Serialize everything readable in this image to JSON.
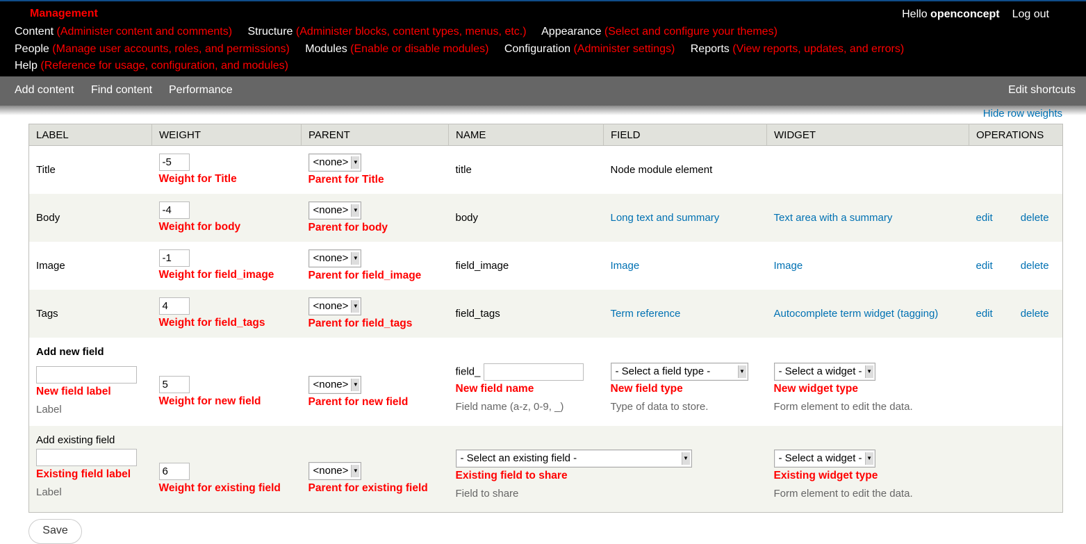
{
  "toolbar": {
    "title": "Management",
    "user_greeting": "Hello",
    "username": "openconcept",
    "logout": "Log out",
    "menu": [
      {
        "label": "Content",
        "desc": "(Administer content and comments)"
      },
      {
        "label": "Structure",
        "desc": "(Administer blocks, content types, menus, etc.)"
      },
      {
        "label": "Appearance",
        "desc": "(Select and configure your themes)"
      },
      {
        "label": "People",
        "desc": "(Manage user accounts, roles, and permissions)"
      },
      {
        "label": "Modules",
        "desc": "(Enable or disable modules)"
      },
      {
        "label": "Configuration",
        "desc": "(Administer settings)"
      },
      {
        "label": "Reports",
        "desc": "(View reports, updates, and errors)"
      },
      {
        "label": "Help",
        "desc": "(Reference for usage, configuration, and modules)"
      }
    ]
  },
  "shortcuts": {
    "items": [
      "Add content",
      "Find content",
      "Performance"
    ],
    "edit": "Edit shortcuts"
  },
  "hide_row_weights": "Hide row weights",
  "table": {
    "headers": [
      "Label",
      "Weight",
      "Parent",
      "Name",
      "Field",
      "Widget",
      "Operations"
    ],
    "rows": [
      {
        "label": "Title",
        "weight": "-5",
        "weight_label": "Weight for Title",
        "parent": "<none>",
        "parent_label": "Parent for Title",
        "name": "title",
        "field": "Node module element",
        "widget": "",
        "edit": "",
        "delete": ""
      },
      {
        "label": "Body",
        "weight": "-4",
        "weight_label": "Weight for body",
        "parent": "<none>",
        "parent_label": "Parent for body",
        "name": "body",
        "field": "Long text and summary",
        "widget": "Text area with a summary",
        "edit": "edit",
        "delete": "delete"
      },
      {
        "label": "Image",
        "weight": "-1",
        "weight_label": "Weight for field_image",
        "parent": "<none>",
        "parent_label": "Parent for field_image",
        "name": "field_image",
        "field": "Image",
        "widget": "Image",
        "edit": "edit",
        "delete": "delete"
      },
      {
        "label": "Tags",
        "weight": "4",
        "weight_label": "Weight for field_tags",
        "parent": "<none>",
        "parent_label": "Parent for field_tags",
        "name": "field_tags",
        "field": "Term reference",
        "widget": "Autocomplete term widget (tagging)",
        "edit": "edit",
        "delete": "delete"
      }
    ],
    "add_new": {
      "title": "Add new field",
      "label_value": "",
      "label_label": "New field label",
      "label_hint": "Label",
      "weight": "5",
      "weight_label": "Weight for new field",
      "parent": "<none>",
      "parent_label": "Parent for new field",
      "name_prefix": "field_",
      "name_value": "",
      "name_label": "New field name",
      "name_hint": "Field name (a-z, 0-9, _)",
      "type": "- Select a field type -",
      "type_label": "New field type",
      "type_hint": "Type of data to store.",
      "widget": "- Select a widget -",
      "widget_label": "New widget type",
      "widget_hint": "Form element to edit the data."
    },
    "add_existing": {
      "title": "Add existing field",
      "label_value": "",
      "label_label": "Existing field label",
      "label_hint": "Label",
      "weight": "6",
      "weight_label": "Weight for existing field",
      "parent": "<none>",
      "parent_label": "Parent for existing field",
      "field": "- Select an existing field -",
      "field_label": "Existing field to share",
      "field_hint": "Field to share",
      "widget": "- Select a widget -",
      "widget_label": "Existing widget type",
      "widget_hint": "Form element to edit the data."
    }
  },
  "save": "Save"
}
